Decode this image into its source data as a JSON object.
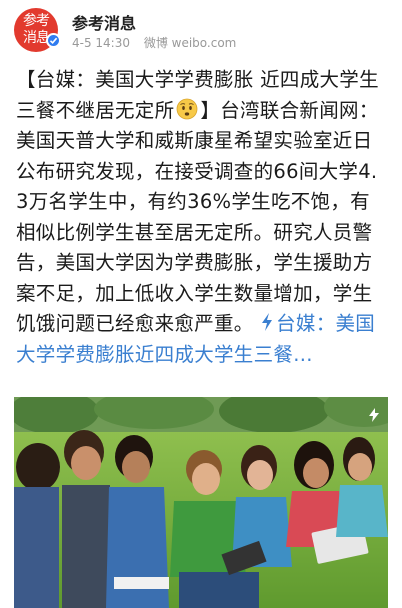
{
  "post": {
    "author": "参考消息",
    "avatar_text_line1": "参考",
    "avatar_text_line2": "消息",
    "time": "4-5 14:30",
    "source": "微博 weibo.com",
    "text_part1": "【台媒：美国大学学费膨胀 近四成大学生三餐不继居无定所",
    "text_part2": "】台湾联合新闻网：美国天普大学和威斯康星希望实验室近日公布研究发现，在接受调查的66间大学4.3万名学生中，有约36%学生吃不饱，有相似比例学生甚至居无定所。研究人员警告，美国大学因为学费膨胀，学生援助方案不足，加上低收入学生数量增加，学生饥饿问题已经愈来愈严重。",
    "link_text": "台媒：美国大学学费膨胀近四成大学生三餐..."
  },
  "icons": {
    "verified": "verified-badge-icon",
    "emoji": "worried-face-emoji-icon",
    "link": "lightning-link-icon",
    "expand": "expand-icon"
  },
  "colors": {
    "link": "#3a7fd0",
    "avatar": "#e23a2e",
    "verified": "#2f7cf0"
  }
}
